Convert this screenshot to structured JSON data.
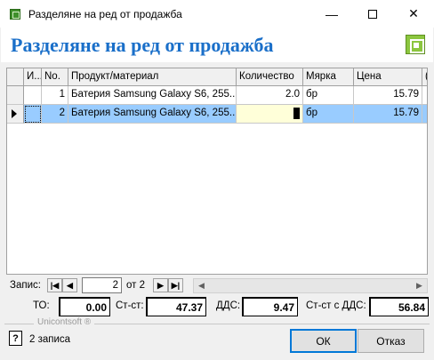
{
  "window": {
    "title": "Разделяне на ред от продажба",
    "minimize": "—",
    "close": "✕"
  },
  "banner": {
    "title": "Разделяне на ред от продажба"
  },
  "grid": {
    "columns": [
      "И...",
      "No.",
      "Продукт/материал",
      "Количество",
      "Мярка",
      "Цена",
      "("
    ],
    "rows": [
      {
        "no": "1",
        "product": "Батерия Samsung Galaxy S6, 255...",
        "quantity": "2.0",
        "unit": "бр",
        "price": "15.79"
      },
      {
        "no": "2",
        "product": "Батерия Samsung Galaxy S6, 255...",
        "quantity": "",
        "unit": "бр",
        "price": "15.79"
      }
    ]
  },
  "navigator": {
    "label": "Запис:",
    "current": "2",
    "of": "от 2",
    "first": "|◀",
    "prev": "◀",
    "next": "▶",
    "last": "▶|",
    "scroll_left": "◀",
    "scroll_right": "▶"
  },
  "totals": {
    "to_label": "ТО:",
    "to_value": "0.00",
    "subtotal_label": "Ст-ст:",
    "subtotal_value": "47.37",
    "vat_label": "ДДС:",
    "vat_value": "9.47",
    "total_label": "Ст-ст с ДДС:",
    "total_value": "56.84"
  },
  "brand": "Unicontsoft ®",
  "footer": {
    "help": "?",
    "records": "2 записа",
    "ok": "ОК",
    "cancel": "Отказ"
  },
  "colors": {
    "banner_title": "#1a6fc9",
    "selection": "#99ccff",
    "edit_cell": "#ffffd9",
    "logo": "#8cc63f"
  }
}
